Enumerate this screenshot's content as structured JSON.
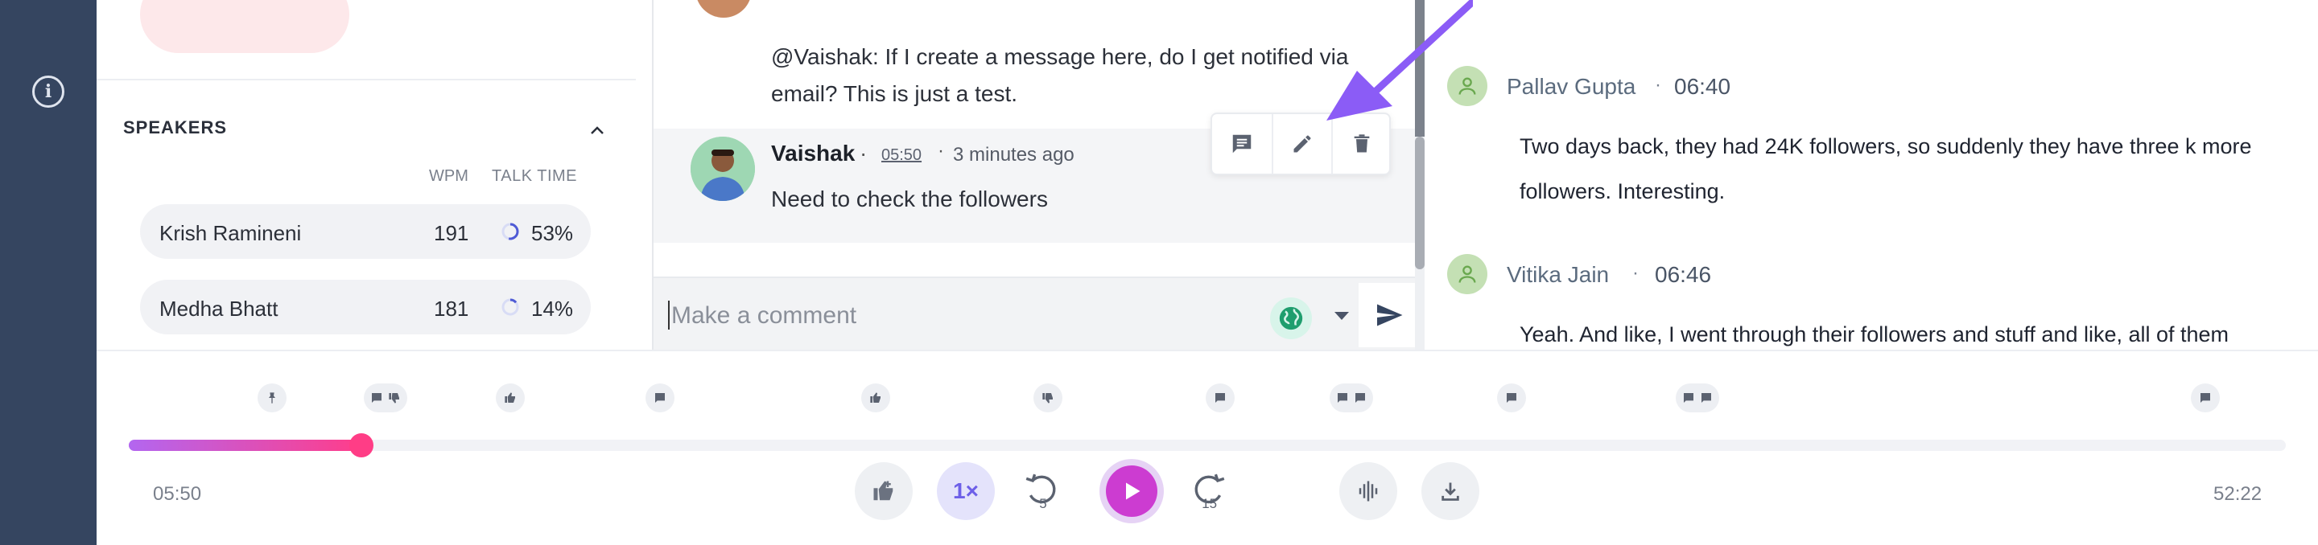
{
  "left_panel": {
    "speakers_title": "SPEAKERS",
    "col_wpm": "WPM",
    "col_talk_time": "TALK TIME",
    "speakers": [
      {
        "name": "Krish Ramineni",
        "wpm": "191",
        "talk_time": "53%",
        "talk_fraction": 0.53
      },
      {
        "name": "Medha Bhatt",
        "wpm": "181",
        "talk_time": "14%",
        "talk_fraction": 0.14
      }
    ]
  },
  "comments": {
    "previous_text": "@Vaishak: If I create a message here, do I get notified via email? This is just a test.",
    "active": {
      "author": "Vaishak",
      "separator": "·",
      "timestamp": "05:50",
      "ago": "3 minutes ago",
      "text": "Need to check the followers"
    },
    "actions": [
      "comment-icon",
      "edit-icon",
      "delete-icon"
    ],
    "input_placeholder": "Make a comment"
  },
  "transcript": [
    {
      "name": "Pallav Gupta",
      "time": "06:40",
      "text_line1": "Two days back, they had 24K followers, so suddenly they have three k more",
      "text_line2": "followers. Interesting."
    },
    {
      "name": "Vitika Jain",
      "time": "06:46",
      "text_line1": "Yeah. And like, I went through their followers and stuff and like, all of them"
    }
  ],
  "player": {
    "current_time": "05:50",
    "total_time": "52:22",
    "progress_fraction": 0.108,
    "speed": "1×",
    "rewind_seconds": "5",
    "forward_seconds": "15",
    "markers": [
      "pin-icon",
      "comment-icon+thumbs-down-icon",
      "thumbs-up-icon",
      "comment-icon",
      "thumbs-up-icon",
      "thumbs-down-icon",
      "comment-icon",
      "comment-icon+comment-icon",
      "comment-icon",
      "comment-icon+comment-icon",
      "comment-icon"
    ]
  },
  "colors": {
    "rail": "#354560",
    "accent_purple": "#8b5cf6",
    "play": "#cc3cd1",
    "progress_start": "#b366f0",
    "progress_end": "#ff3d8a"
  }
}
